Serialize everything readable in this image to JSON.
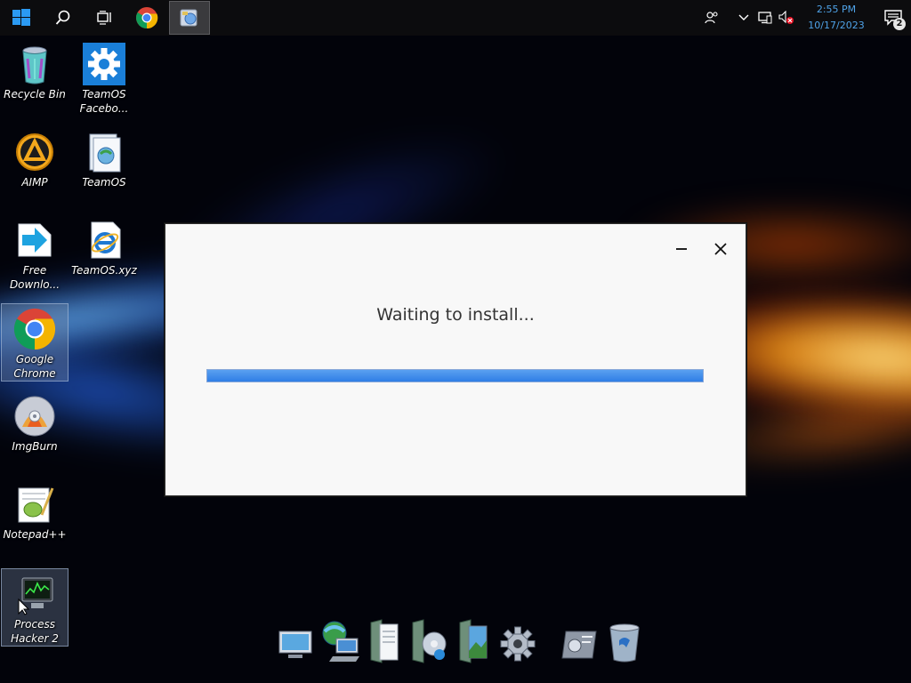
{
  "taskbar": {
    "start": {
      "icon": "windows-logo-icon"
    },
    "search": {
      "icon": "search-icon"
    },
    "task_view": {
      "icon": "task-view-icon"
    },
    "pinned": [
      {
        "name": "chrome-taskbar-icon"
      },
      {
        "name": "installer-taskbar-icon"
      }
    ],
    "tray": {
      "icons": [
        "people-icon",
        "chevron-up-icon",
        "network-icon",
        "volume-muted-icon"
      ],
      "time": "2:55 PM",
      "date": "10/17/2023",
      "notification_count": "2"
    }
  },
  "desktop": {
    "icons": [
      {
        "label": "Recycle Bin",
        "icon": "recycle-bin-icon"
      },
      {
        "label": "TeamOS Facebo...",
        "icon": "gear-icon"
      },
      {
        "label": "AIMP",
        "icon": "aimp-icon"
      },
      {
        "label": "TeamOS",
        "icon": "teamos-icon"
      },
      {
        "label": "Free Downlo...",
        "icon": "download-arrow-icon"
      },
      {
        "label": "TeamOS.xyz",
        "icon": "internet-explorer-icon"
      },
      {
        "label": "Google Chrome",
        "icon": "chrome-icon"
      },
      {
        "label": "ImgBurn",
        "icon": "disc-icon"
      },
      {
        "label": "Notepad++",
        "icon": "notepad-icon"
      },
      {
        "label": "Process Hacker 2",
        "icon": "process-hacker-icon"
      }
    ]
  },
  "dialog": {
    "message": "Waiting to install...",
    "progress": 1.0
  },
  "dock": {
    "items": [
      "computer-icon",
      "network-icon",
      "documents-icon",
      "music-icon",
      "pictures-icon",
      "settings-icon",
      "control-panel-icon",
      "recycle-bin-icon"
    ]
  },
  "colors": {
    "clock": "#4fa3e8",
    "progress_fill": "#3a8aee",
    "dialog_bg": "#f8f8f8"
  }
}
